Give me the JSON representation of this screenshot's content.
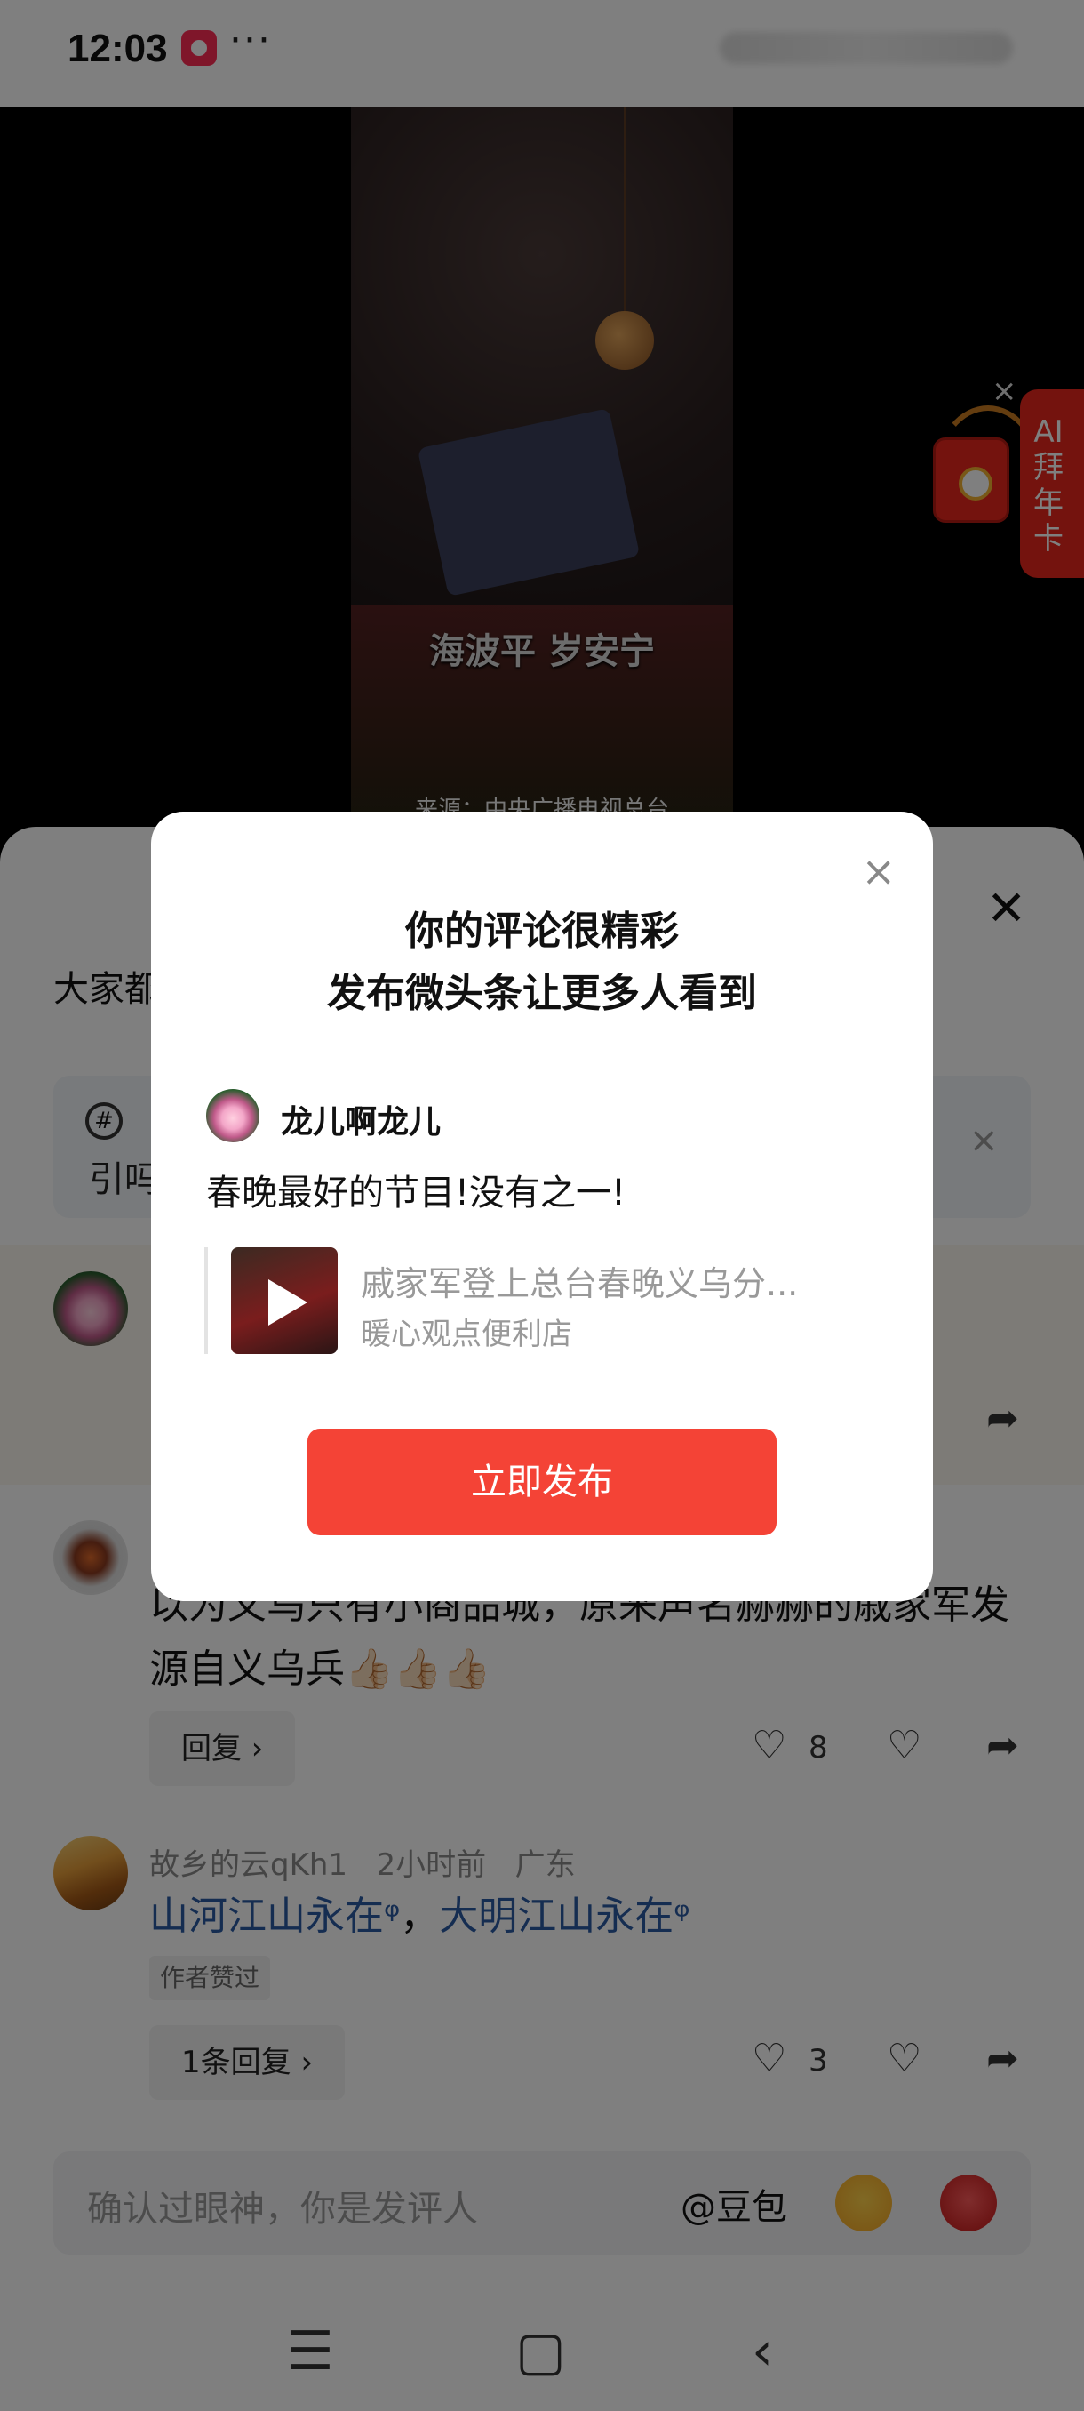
{
  "status_bar": {
    "time": "12:03",
    "more": "···"
  },
  "video": {
    "caption": "海波平 岁安宁",
    "source": "来源：中央广播电视总台"
  },
  "ai_card": {
    "label": "AI拜年卡",
    "close": "×"
  },
  "sheet": {
    "close": "✕",
    "title_prefix": "大家都",
    "hint_text": "引吗",
    "hint_icon": "#",
    "hint_close": "×"
  },
  "comments": [
    {
      "avatar": "lotus",
      "text": "以为义乌只有小商品城，原来声名赫赫的戚家军发源自义乌兵👍🏻👍🏻👍🏻",
      "reply_label": "回复 ›",
      "likes": "8"
    },
    {
      "avatar": "dune",
      "author": "故乡的云qKh1",
      "time": "2小时前",
      "location": "广东",
      "text_link1": "山河江山永在",
      "text_sep": "，",
      "text_link2": "大明江山永在",
      "author_tag": "作者赞过",
      "reply_label": "1条回复 ›",
      "likes": "3"
    }
  ],
  "input_bar": {
    "placeholder": "确认过眼神，你是发评人",
    "doubao": "@豆包"
  },
  "popup": {
    "close": "×",
    "title_line1": "你的评论很精彩",
    "title_line2": "发布微头条让更多人看到",
    "user_name": "龙儿啊龙儿",
    "comment": "春晚最好的节目!没有之一!",
    "ref_title": "戚家军登上总台春晚义乌分...",
    "ref_source": "暖心观点便利店",
    "button": "立即发布"
  },
  "nav": {
    "menu": "☰",
    "home": "▢",
    "back": "‹"
  }
}
